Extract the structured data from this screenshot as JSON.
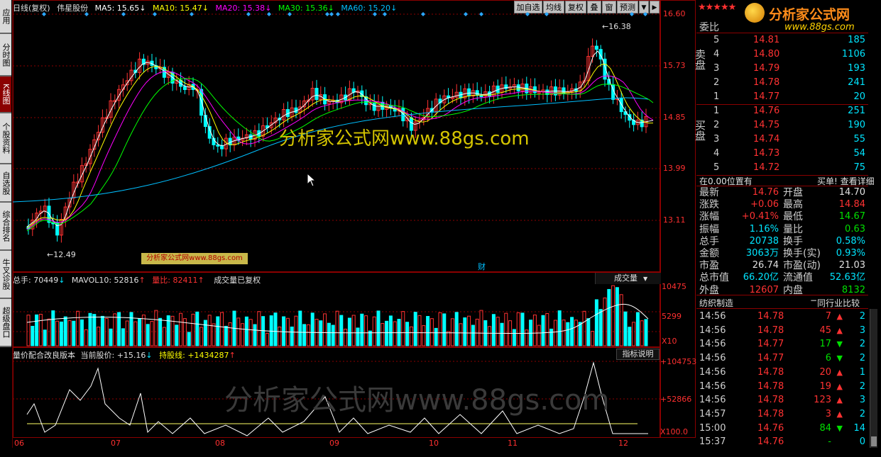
{
  "left_tabs": [
    {
      "label": "应用",
      "active": false
    },
    {
      "label": "分时图",
      "active": false
    },
    {
      "label": "K线图",
      "active": true
    },
    {
      "label": "个股资料",
      "active": false
    },
    {
      "label": "自选股",
      "active": false
    },
    {
      "label": "综合排名",
      "active": false
    },
    {
      "label": "牛叉诊股",
      "active": false
    },
    {
      "label": "超级盘口",
      "active": false
    }
  ],
  "kline": {
    "period": "日线(复权)",
    "stock_name": "伟星股份",
    "ma5": "MA5: 15.65",
    "ma10": "MA10: 15.47",
    "ma20": "MA20: 15.38",
    "ma30": "MA30: 15.36",
    "ma60": "MA60: 15.20",
    "high_label": "16.38",
    "low_label": "12.49",
    "cai_mark": "财",
    "y_labels": [
      "16.60",
      "15.73",
      "14.85",
      "13.99",
      "13.11"
    ],
    "watermark": "分析家公式网www.88gs.com",
    "small_watermark": "分析家公式网www.88gs.com"
  },
  "toolbar": {
    "add_watch": "加自选",
    "ma_line": "均线",
    "restore": "复权",
    "overlay": "叠",
    "window": "窗",
    "predict": "预测",
    "menu": "▼",
    "next": "▶"
  },
  "volume": {
    "total": "总手: 70449",
    "mavol": "MAVOL10: 52816",
    "ratio": "量比: 82411",
    "note": "成交量已复权",
    "dropdown": "成交量",
    "y_labels": [
      "10475",
      "5299",
      "X10"
    ]
  },
  "indicator": {
    "title": "量价配合改良版本",
    "current": "当前股价: +15.16",
    "holding": "持股线: +1434287",
    "help": "指标说明",
    "y_labels": [
      "+104753",
      "+52866",
      "X100.0"
    ],
    "bg_watermark": "分析家公式网www.88gs.com"
  },
  "x_axis": [
    "06",
    "07",
    "08",
    "09",
    "10",
    "11",
    "12"
  ],
  "quote_panel": {
    "stars": "★★★★★",
    "logo_text": "分析家公式网",
    "logo_url": "www.88gs.com",
    "weibi": "委比",
    "sell_side": "卖盘",
    "buy_side": "买盘",
    "sells": [
      {
        "n": "5",
        "price": "14.81",
        "vol": "185"
      },
      {
        "n": "4",
        "price": "14.80",
        "vol": "1106"
      },
      {
        "n": "3",
        "price": "14.79",
        "vol": "193"
      },
      {
        "n": "2",
        "price": "14.78",
        "vol": "241"
      },
      {
        "n": "1",
        "price": "14.77",
        "vol": "20"
      }
    ],
    "buys": [
      {
        "n": "1",
        "price": "14.76",
        "vol": "251"
      },
      {
        "n": "2",
        "price": "14.75",
        "vol": "190"
      },
      {
        "n": "3",
        "price": "14.74",
        "vol": "55"
      },
      {
        "n": "4",
        "price": "14.73",
        "vol": "54"
      },
      {
        "n": "5",
        "price": "14.72",
        "vol": "75"
      }
    ],
    "position": "在0.00位置有",
    "buy_detail": "买单! 查看详细",
    "stats": [
      {
        "l1": "最新",
        "v1": "14.76",
        "c1": "red",
        "l2": "开盘",
        "v2": "14.70",
        "c2": "wht"
      },
      {
        "l1": "涨跌",
        "v1": "+0.06",
        "c1": "red",
        "l2": "最高",
        "v2": "14.84",
        "c2": "red"
      },
      {
        "l1": "涨幅",
        "v1": "+0.41%",
        "c1": "red",
        "l2": "最低",
        "v2": "14.67",
        "c2": "grn"
      },
      {
        "l1": "振幅",
        "v1": "1.16%",
        "c1": "cyan",
        "l2": "量比",
        "v2": "0.63",
        "c2": "grn"
      },
      {
        "l1": "总手",
        "v1": "20738",
        "c1": "cyan",
        "l2": "换手",
        "v2": "0.58%",
        "c2": "cyan"
      },
      {
        "l1": "金额",
        "v1": "3063万",
        "c1": "cyan",
        "l2": "换手(实)",
        "v2": "0.93%",
        "c2": "cyan"
      },
      {
        "l1": "市盈",
        "v1": "26.74",
        "c1": "wht",
        "l2": "市盈(动)",
        "v2": "21.03",
        "c2": "wht"
      },
      {
        "l1": "总市值",
        "v1": "66.20亿",
        "c1": "cyan",
        "l2": "流通值",
        "v2": "52.63亿",
        "c2": "cyan"
      },
      {
        "l1": "外盘",
        "v1": "12607",
        "c1": "red",
        "l2": "内盘",
        "v2": "8132",
        "c2": "grn"
      }
    ],
    "industry": "纺织制造",
    "industry_compare": "同行业比较",
    "ticks": [
      {
        "t": "14:56",
        "p": "14.78",
        "v": "7",
        "d": "up",
        "n": "2"
      },
      {
        "t": "14:56",
        "p": "14.78",
        "v": "45",
        "d": "up",
        "n": "3"
      },
      {
        "t": "14:56",
        "p": "14.77",
        "v": "17",
        "d": "down",
        "n": "2"
      },
      {
        "t": "14:56",
        "p": "14.77",
        "v": "6",
        "d": "down",
        "n": "2"
      },
      {
        "t": "14:56",
        "p": "14.78",
        "v": "20",
        "d": "up",
        "n": "1"
      },
      {
        "t": "14:56",
        "p": "14.78",
        "v": "19",
        "d": "up",
        "n": "2"
      },
      {
        "t": "14:56",
        "p": "14.78",
        "v": "123",
        "d": "up",
        "n": "3"
      },
      {
        "t": "14:57",
        "p": "14.78",
        "v": "3",
        "d": "up",
        "n": "2"
      },
      {
        "t": "15:00",
        "p": "14.76",
        "v": "84",
        "d": "down",
        "n": "14"
      },
      {
        "t": "15:37",
        "p": "14.76",
        "v": "-",
        "d": "none",
        "n": "0"
      }
    ]
  },
  "colors": {
    "up": "#ff3232",
    "down": "#00ffff",
    "grid": "#8b0000",
    "ma5": "#ffffff",
    "ma10": "#ffff00",
    "ma20": "#ff00ff",
    "ma30": "#00ff00",
    "ma60": "#00bfff",
    "panel_bg": "#000000"
  }
}
